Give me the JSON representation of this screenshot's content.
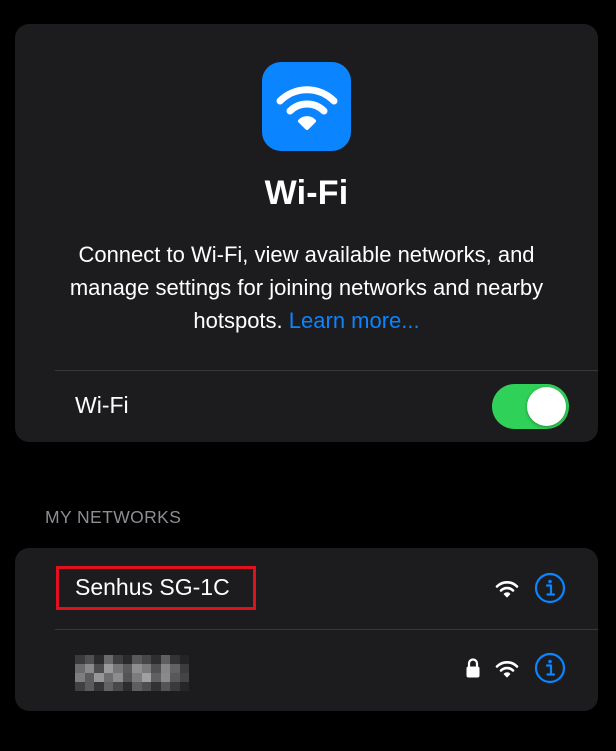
{
  "header": {
    "title": "Wi-Fi",
    "description": "Connect to Wi-Fi, view available networks, and manage settings for joining networks and nearby hotspots.",
    "learn_more": "Learn more...",
    "icon": "wifi-icon",
    "accent_color": "#0a84ff"
  },
  "wifi_toggle": {
    "label": "Wi-Fi",
    "state": "on",
    "on_color": "#30d158"
  },
  "my_networks": {
    "section_title": "MY NETWORKS",
    "items": [
      {
        "name": "Senhus SG-1C",
        "secured": false,
        "icons": [
          "wifi-signal-icon",
          "info-icon"
        ],
        "highlighted": true,
        "highlight_color": "#e0101e"
      },
      {
        "name": "",
        "name_obscured": true,
        "secured": true,
        "icons": [
          "lock-icon",
          "wifi-signal-icon",
          "info-icon"
        ]
      }
    ]
  }
}
